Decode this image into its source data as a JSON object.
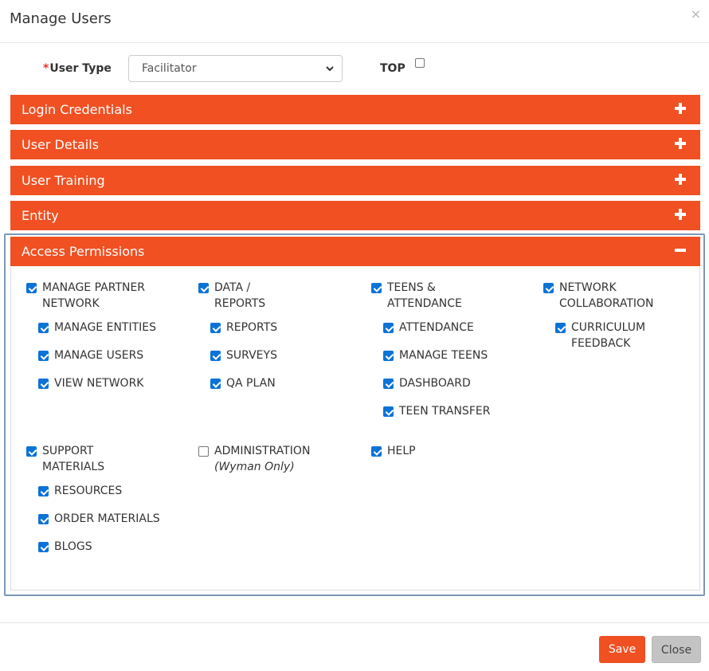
{
  "modal": {
    "title": "Manage Users",
    "close_icon": "×"
  },
  "user_type": {
    "required_mark": "*",
    "label": "User Type",
    "selected": "Facilitator",
    "top_label": "TOP",
    "top_checked": false
  },
  "panels": {
    "login": {
      "label": "Login Credentials",
      "icon": "plus-icon"
    },
    "details": {
      "label": "User Details",
      "icon": "plus-icon"
    },
    "training": {
      "label": "User Training",
      "icon": "plus-icon"
    },
    "entity": {
      "label": "Entity",
      "icon": "plus-icon"
    },
    "access": {
      "label": "Access Permissions",
      "icon": "minus-icon"
    }
  },
  "permissions": {
    "partner": {
      "line1": "Manage Partner",
      "line2": "Network",
      "checked": true,
      "children": [
        "Manage Entities",
        "Manage Users",
        "View Network"
      ]
    },
    "data": {
      "line1": "Data /",
      "line2": "Reports",
      "checked": true,
      "children": [
        "Reports",
        "Surveys",
        "QA Plan"
      ]
    },
    "teens": {
      "line1": "Teens &",
      "line2": "Attendance",
      "checked": true,
      "children": [
        "Attendance",
        "Manage Teens",
        "Dashboard",
        "Teen Transfer"
      ]
    },
    "network": {
      "line1": "Network",
      "line2": "Collaboration",
      "checked": true,
      "child_line1": "Curriculum",
      "child_line2": "Feedback"
    },
    "support": {
      "line1": "Support",
      "line2": "Materials",
      "checked": true,
      "children": [
        "Resources",
        "Order Materials",
        "Blogs"
      ]
    },
    "admin": {
      "label": "Administration",
      "note": "(Wyman Only)",
      "checked": false
    },
    "help": {
      "label": "Help",
      "checked": true
    }
  },
  "footer": {
    "save_label": "Save",
    "close_label": "Close"
  },
  "colors": {
    "accent": "#f05022",
    "checkbox": "#0b73d6",
    "outline": "#7b98b8"
  }
}
